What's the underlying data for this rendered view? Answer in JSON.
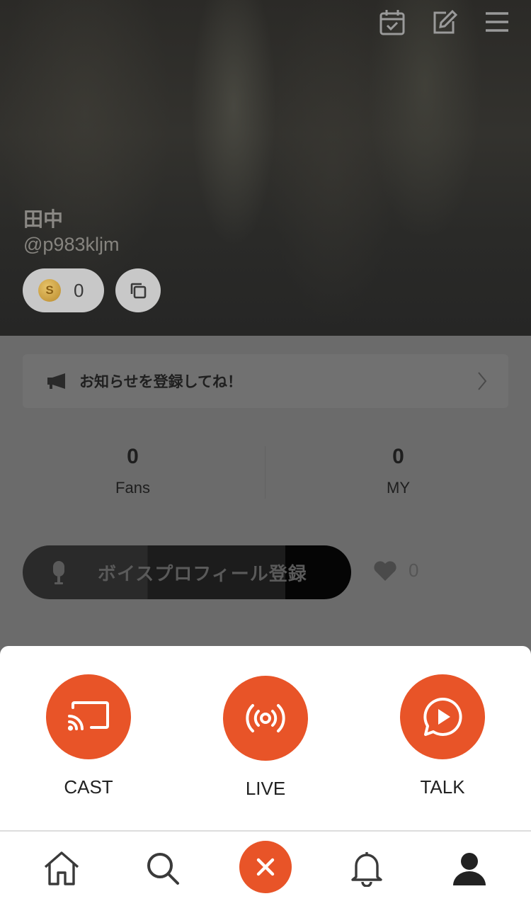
{
  "profile": {
    "name": "田中",
    "handle": "@p983kljm",
    "coin_symbol": "S",
    "coin_count": "0"
  },
  "header_icons": [
    "calendar-check-icon",
    "edit-icon",
    "menu-icon"
  ],
  "notice": {
    "text": "お知らせを登録してね！"
  },
  "stats": [
    {
      "value": "0",
      "label": "Fans"
    },
    {
      "value": "0",
      "label": "MY"
    }
  ],
  "voice_profile": {
    "label": "ボイスプロフィール登録",
    "likes": "0"
  },
  "actions": [
    {
      "label": "CAST",
      "icon": "cast-icon"
    },
    {
      "label": "LIVE",
      "icon": "broadcast-icon"
    },
    {
      "label": "TALK",
      "icon": "talk-icon"
    }
  ],
  "tabbar": [
    "home-icon",
    "search-icon",
    "close-icon",
    "bell-icon",
    "profile-icon"
  ],
  "colors": {
    "accent": "#e85428",
    "overlay": "#6b6b6b"
  }
}
